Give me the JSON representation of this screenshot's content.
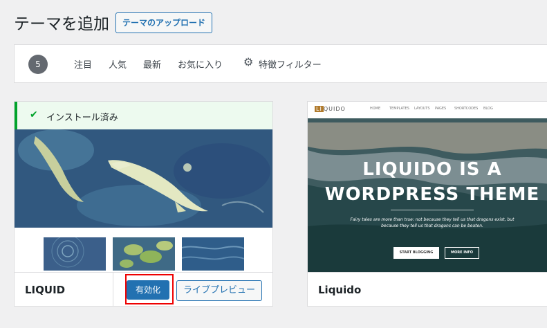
{
  "header": {
    "title": "テーマを追加",
    "upload_label": "テーマのアップロード"
  },
  "filter": {
    "count": "5",
    "links": [
      "注目",
      "人気",
      "最新",
      "お気に入り"
    ],
    "feature_filter_label": "特徴フィルター"
  },
  "themes": [
    {
      "name": "LIQUID",
      "installed_label": "インストール済み",
      "activate_label": "有効化",
      "preview_label": "ライブプレビュー"
    },
    {
      "name": "Liquido",
      "screenshot": {
        "logo": "QUIDO",
        "logo_box": "LI",
        "nav": [
          "HOME",
          "TEMPLATES",
          "LAYOUTS",
          "PAGES",
          "SHORTCODES",
          "BLOG"
        ],
        "hero_title": [
          "LIQUIDO IS A",
          "WORDPRESS THEME"
        ],
        "hero_text": "Fairy tales are more than true: not because they tell us that dragons exist, but because they tell us that dragons can be beaten.",
        "btn_start": "START BLOGGING",
        "btn_more": "MORE INFO"
      }
    }
  ],
  "colors": {
    "accent": "#2271b1",
    "success": "#00a32a",
    "highlight": "#e00000"
  }
}
